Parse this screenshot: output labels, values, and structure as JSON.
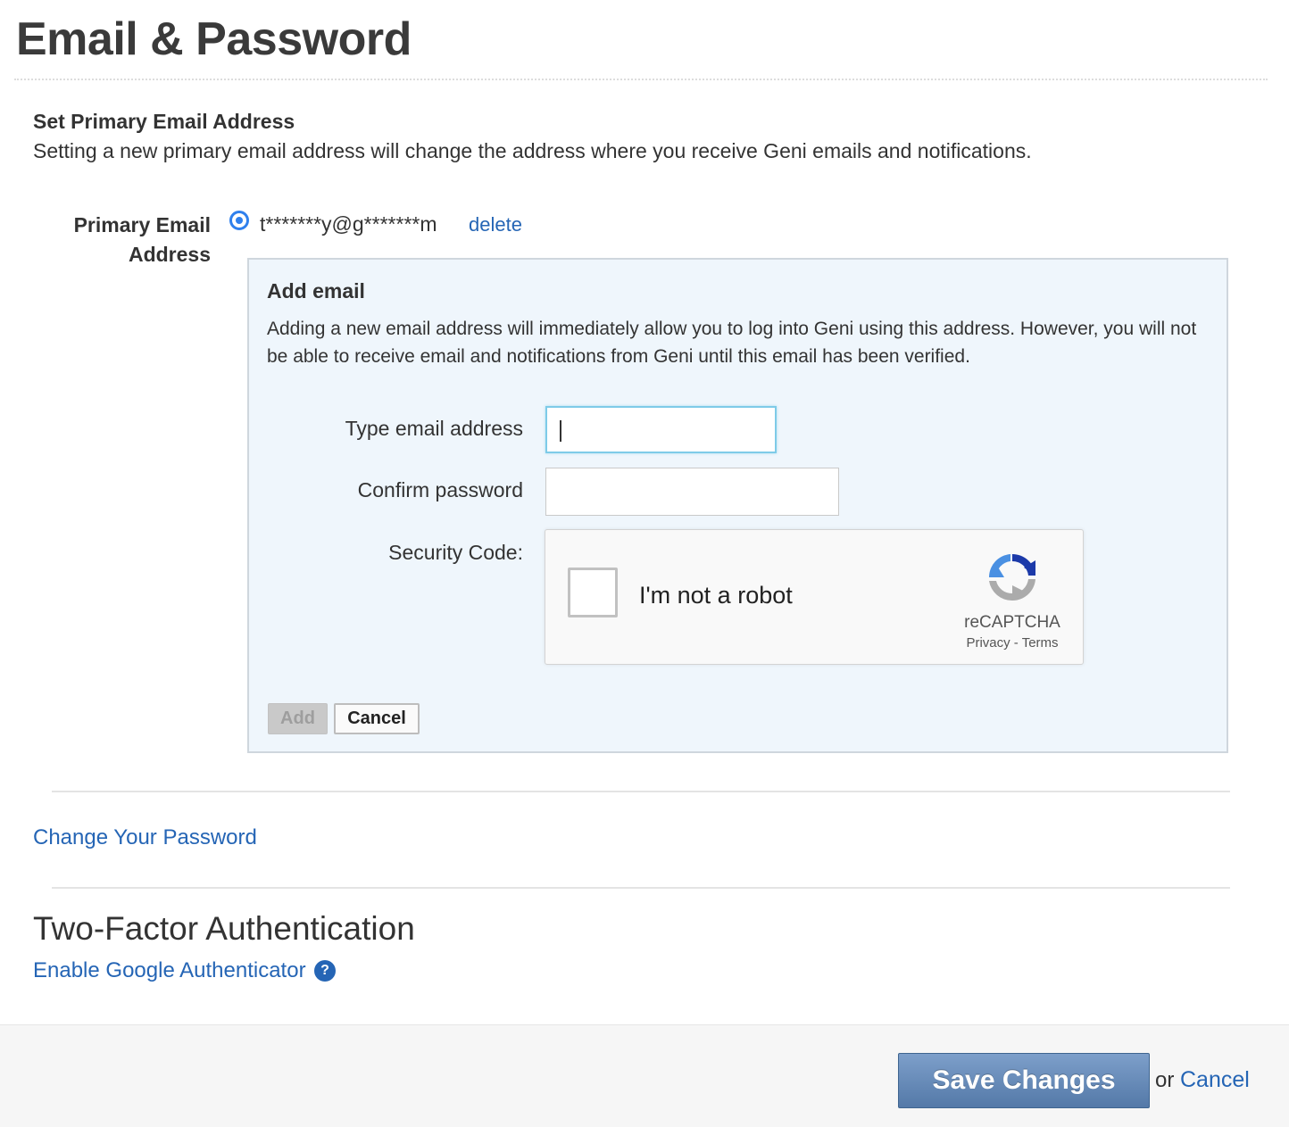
{
  "page": {
    "title": "Email & Password"
  },
  "primary_email_section": {
    "heading": "Set Primary Email Address",
    "description": "Setting a new primary email address will change the address where you receive Geni emails and notifications.",
    "field_label_line1": "Primary Email",
    "field_label_line2": "Address",
    "email_value": "t*******y@g*******m",
    "email_selected": true,
    "delete_label": "delete"
  },
  "add_email": {
    "title": "Add email",
    "description": "Adding a new email address will immediately allow you to log into Geni using this address. However, you will not be able to receive email and notifications from Geni until this email has been verified.",
    "email_label": "Type email address",
    "email_value": "",
    "password_label": "Confirm password",
    "password_value": "",
    "security_label": "Security Code:",
    "recaptcha": {
      "checkbox_label": "I'm not a robot",
      "checked": false,
      "brand": "reCAPTCHA",
      "privacy": "Privacy",
      "separator": " - ",
      "terms": "Terms",
      "logo_icon": "recaptcha-logo-icon"
    },
    "add_button": "Add",
    "add_disabled": true,
    "cancel_button": "Cancel"
  },
  "password": {
    "change_link": "Change Your Password"
  },
  "two_factor": {
    "title": "Two-Factor Authentication",
    "enable_link": "Enable Google Authenticator",
    "help_icon": "?"
  },
  "footer": {
    "save_button": "Save Changes",
    "or_text": "or",
    "cancel_link": "Cancel"
  },
  "colors": {
    "link": "#2565b5",
    "radio_accent": "#2f80ed",
    "panel_background": "#eff6fc",
    "save_button": "#6689b8",
    "focused_input_border": "#7ecbe8"
  }
}
